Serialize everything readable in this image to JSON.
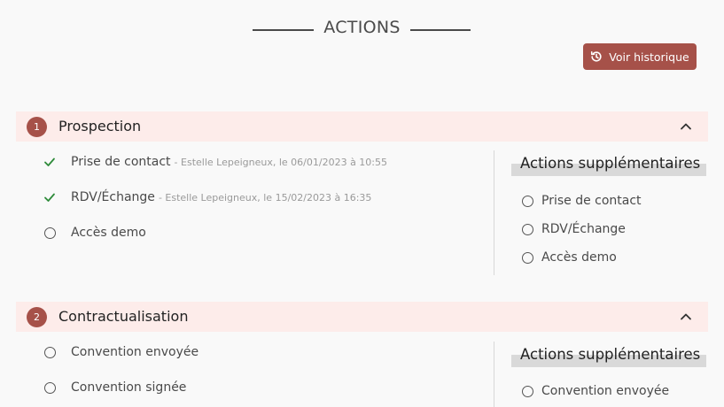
{
  "header": {
    "title": "ACTIONS",
    "history_button": {
      "label": "Voir historique",
      "icon": "history-icon"
    }
  },
  "colors": {
    "accent": "#a65149",
    "section_bg": "#fdecea",
    "check": "#2e8b3a"
  },
  "sections": [
    {
      "number": "1",
      "title": "Prospection",
      "expanded": true,
      "steps": [
        {
          "label": "Prise de contact",
          "meta": "- Estelle Lepeigneux, le 06/01/2023 à 10:55",
          "done": true
        },
        {
          "label": "RDV/Échange",
          "meta": "- Estelle Lepeigneux, le 15/02/2023 à 16:35",
          "done": true
        },
        {
          "label": "Accès demo",
          "meta": "",
          "done": false
        }
      ],
      "extra": {
        "title": "Actions supplémentaires",
        "items": [
          "Prise de contact",
          "RDV/Échange",
          "Accès demo"
        ]
      }
    },
    {
      "number": "2",
      "title": "Contractualisation",
      "expanded": true,
      "steps": [
        {
          "label": "Convention envoyée",
          "meta": "",
          "done": false
        },
        {
          "label": "Convention signée",
          "meta": "",
          "done": false
        }
      ],
      "extra": {
        "title": "Actions supplémentaires",
        "items": [
          "Convention envoyée"
        ]
      }
    }
  ]
}
